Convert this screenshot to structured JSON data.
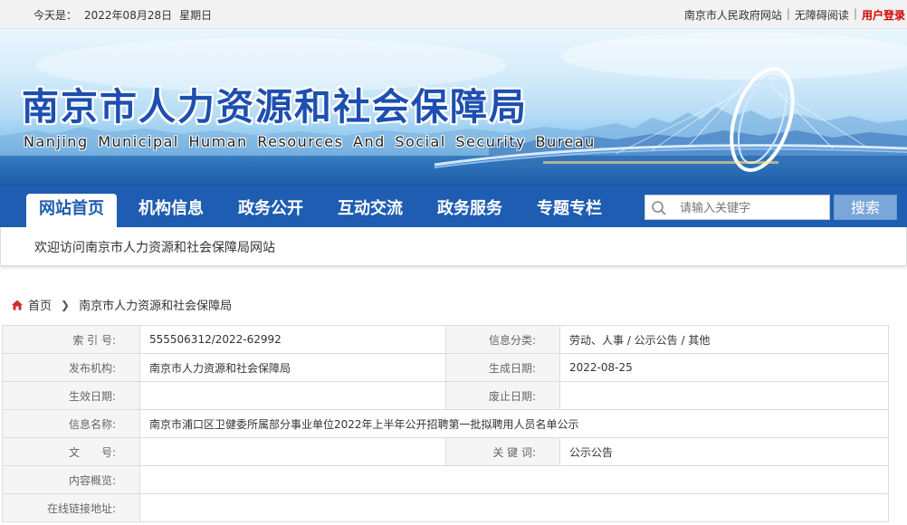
{
  "topbar": {
    "date_label": "今天是：",
    "date": "2022年08月28日",
    "weekday": "星期日",
    "links": {
      "gov": "南京市人民政府网站",
      "accessible": "无障碍阅读",
      "login": "用户登录"
    }
  },
  "banner": {
    "title_cn": "南京市人力资源和社会保障局",
    "title_en": "Nanjing Municipal Human Resources And Social Security Bureau"
  },
  "nav": {
    "items": [
      "网站首页",
      "机构信息",
      "政务公开",
      "互动交流",
      "政务服务",
      "专题专栏"
    ],
    "search_placeholder": "请输入关键字",
    "search_button": "搜索"
  },
  "welcome": "欢迎访问南京市人力资源和社会保障局网站",
  "breadcrumb": {
    "home": "首页",
    "current": "南京市人力资源和社会保障局"
  },
  "info": {
    "index_label": "索 引 号:",
    "index_value": "555506312/2022-62992",
    "category_label": "信息分类:",
    "category_value": "劳动、人事 / 公示公告 / 其他",
    "publisher_label": "发布机构:",
    "publisher_value": "南京市人力资源和社会保障局",
    "created_label": "生成日期:",
    "created_value": "2022-08-25",
    "effective_label": "生效日期:",
    "effective_value": "",
    "abolish_label": "废止日期:",
    "abolish_value": "",
    "name_label": "信息名称:",
    "name_value": "南京市浦口区卫健委所属部分事业单位2022年上半年公开招聘第一批拟聘用人员名单公示",
    "docno_label": "文　　号:",
    "docno_value": "",
    "keyword_label": "关 键 词:",
    "keyword_value": "公示公告",
    "summary_label": "内容概览:",
    "summary_value": "",
    "link_label": "在线链接地址:",
    "link_value": ""
  },
  "colors": {
    "nav_blue": "#1e5db1",
    "login_red": "#d40000",
    "search_button": "#7aa7d8"
  }
}
